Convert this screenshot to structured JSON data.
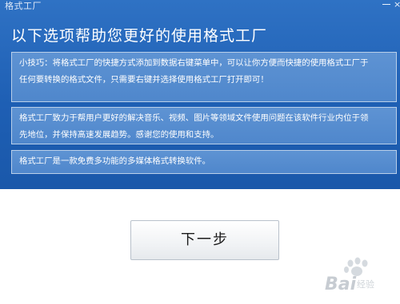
{
  "window": {
    "title": "格式工厂",
    "heading": "以下选项帮助您更好的使用格式工厂"
  },
  "tips": [
    {
      "lines": [
        "小技巧：将格式工厂的快捷方式添加到数据右键菜单中，可以让你方便而快捷的使用格式工厂于",
        "任何要转换的格式文件，只需要右键并选择使用格式工厂打开即可！"
      ]
    },
    {
      "lines": [
        "格式工厂致力于帮用户更好的解决音乐、视频、图片等领域文件使用问题在该软件行业内位于领",
        "先地位，并保持高速发展趋势。感谢您的使用和支持。"
      ]
    },
    {
      "lines": [
        "格式工厂是一款免费多功能的多媒体格式转换软件。"
      ]
    }
  ],
  "buttons": {
    "next": "下一步"
  },
  "watermark": {
    "logo_text": "Bai",
    "sub_text": "经验"
  },
  "colors": {
    "header_bg": "#2468bd",
    "panel_bg": "#5a8fd1",
    "panel_border": "#b9cfe9",
    "text_light": "#ffffff"
  }
}
